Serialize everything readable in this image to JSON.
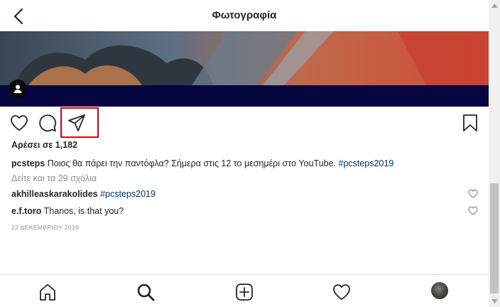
{
  "header": {
    "title": "Φωτογραφία",
    "back_icon": "chevron-left-icon"
  },
  "post": {
    "likes_text": "Αρέσει σε 1,182",
    "caption": {
      "username": "pcsteps",
      "text": "Ποιος θα πάρει την παντόφλα? Σήμερα στις 12 το μεσημέρι στο YouTube.",
      "hashtag": "#pcsteps2019"
    },
    "view_all_comments": "Δείτε και τα 29 σχόλια",
    "comments": [
      {
        "username": "akhilleaskarakolides",
        "text": "",
        "hashtag": "#pcsteps2019"
      },
      {
        "username": "e.f.toro",
        "text": "Thanos, is that you?",
        "hashtag": ""
      }
    ],
    "date": "22 ΔΕΚΕΜΒΡΙΟΥ 2019"
  },
  "action_icons": [
    "heart-icon",
    "comment-icon",
    "share-icon",
    "bookmark-icon"
  ],
  "bottom_nav": [
    "home-icon",
    "search-icon",
    "new-post-icon",
    "activity-heart-icon",
    "profile-avatar"
  ],
  "colors": {
    "text": "#262626",
    "muted": "#8e8e8e",
    "hashtag": "#003569",
    "highlight": "#e3000f",
    "photo_bg": "#05063f"
  }
}
